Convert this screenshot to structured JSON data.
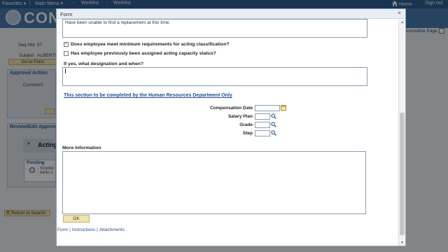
{
  "topbar": {
    "favorites": "Favorites",
    "main_menu": "Main Menu",
    "crumb1": "Worklist",
    "crumb2": "Worklist",
    "home": "Home",
    "sign_out": "Sign out"
  },
  "banner": {
    "logo_text": "CON"
  },
  "background": {
    "seq_label": "Seq Nbr",
    "seq_value": "97",
    "subject_label": "Subject",
    "subject_value": "ALBERTS",
    "go_to_form": "Go to Form",
    "approval_action": "Approval Action",
    "comment_label": "Comment",
    "review_edit": "Review/Edit Approv",
    "acting": "Acting",
    "pending": "Pending",
    "snyder": "Snyder",
    "admin": "Admin C",
    "return_to_search": "Return to Search",
    "personalize": "ersonalize Page"
  },
  "modal": {
    "title": "Form",
    "close": "×",
    "top_textarea": "Have been unable to find a replacement at this time.",
    "q1": "Does employee meet minimum requirements for acting classification?",
    "q1_checked": "✓",
    "q2": "Has employee previously been assigned acting capacity status?",
    "q3": "If yes, what designation and when?",
    "hr_section": "This section to be completed by the Human Resources Department Only",
    "fields": {
      "comp_date": "Compensation Date",
      "salary_plan": "Salary Plan",
      "grade": "Grade",
      "step": "Step"
    },
    "more_info": "More Information",
    "ok": "OK",
    "footer": {
      "form": "Form",
      "instructions": "Instructions",
      "attachments": "Attachments"
    }
  },
  "colors": {
    "nav_bg": "#2f5f92",
    "banner_bg": "#4a7bb0",
    "link": "#1f4f8a",
    "button_bg": "#f0e3b0"
  }
}
